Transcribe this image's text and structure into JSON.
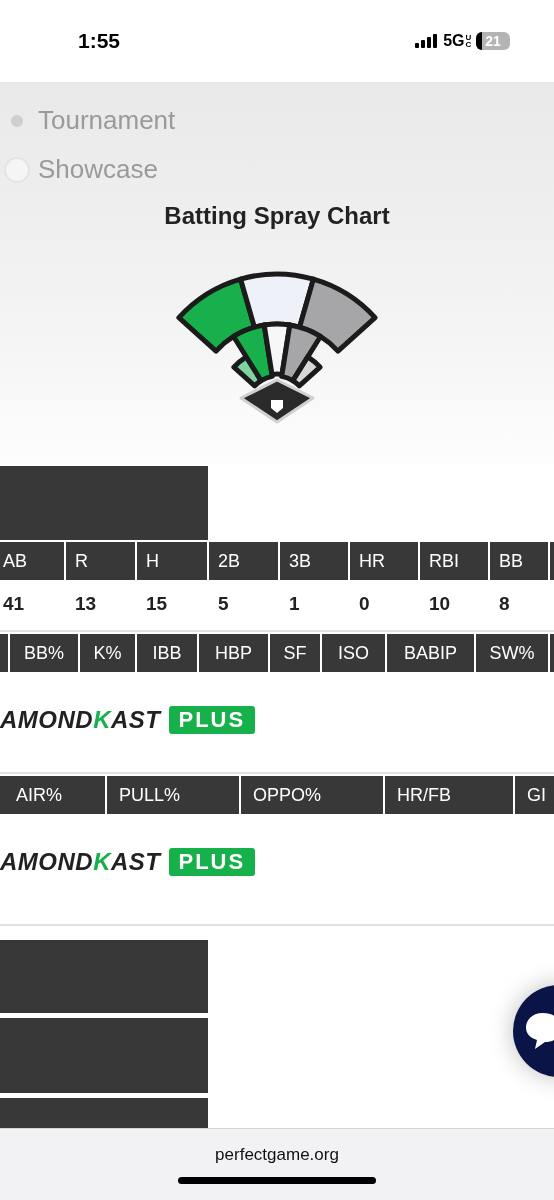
{
  "status_bar": {
    "time": "1:55",
    "network": "5G",
    "network_badge": "UC",
    "battery": "21"
  },
  "event_types": [
    {
      "label": "Tournament",
      "selected": true
    },
    {
      "label": "Showcase",
      "selected": false
    }
  ],
  "spray_chart": {
    "title": "Batting Spray Chart"
  },
  "stat_tables": [
    {
      "columns": [
        "AB",
        "R",
        "H",
        "2B",
        "3B",
        "HR",
        "RBI",
        "BB"
      ],
      "values": [
        "41",
        "13",
        "15",
        "5",
        "1",
        "0",
        "10",
        "8"
      ]
    },
    {
      "columns": [
        "BB%",
        "K%",
        "IBB",
        "HBP",
        "SF",
        "ISO",
        "BABIP",
        "SW%"
      ],
      "brand": {
        "wordmark": [
          "AMOND",
          "K",
          "AST"
        ],
        "badge": "PLUS"
      }
    },
    {
      "columns": [
        "AIR%",
        "PULL%",
        "OPPO%",
        "HR/FB",
        "GI"
      ],
      "brand": {
        "wordmark": [
          "AMOND",
          "K",
          "AST"
        ],
        "badge": "PLUS"
      }
    }
  ],
  "browser": {
    "url": "perfectgame.org"
  }
}
